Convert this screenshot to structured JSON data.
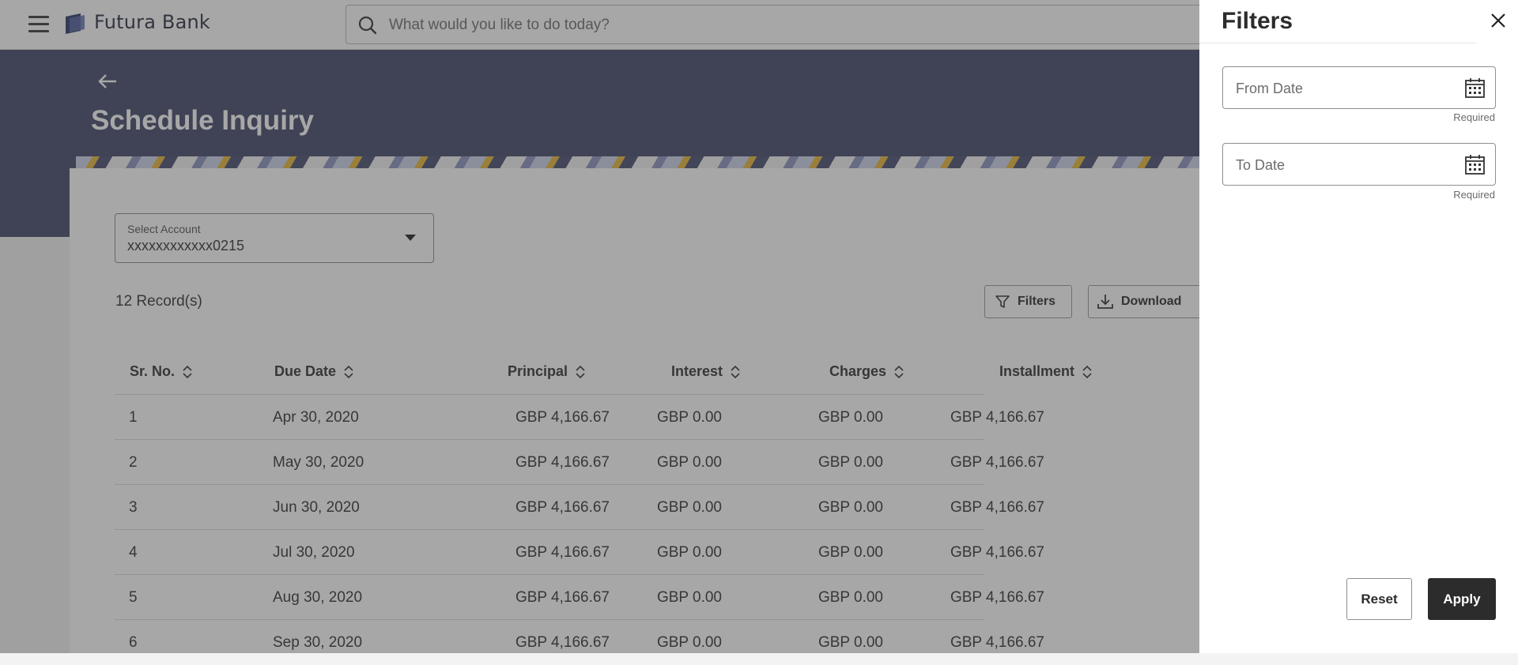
{
  "header": {
    "brand": "Futura Bank",
    "search_placeholder": "What would you like to do today?"
  },
  "page": {
    "title": "Schedule Inquiry"
  },
  "account": {
    "label": "Select Account",
    "value": "xxxxxxxxxxxx0215"
  },
  "records": "12 Record(s)",
  "toolbar": {
    "filters_label": "Filters",
    "download_label": "Download"
  },
  "table": {
    "columns": [
      "Sr. No.",
      "Due Date",
      "Principal",
      "Interest",
      "Charges",
      "Installment"
    ],
    "rows": [
      {
        "sr": "1",
        "due": "Apr 30, 2020",
        "principal": "GBP 4,166.67",
        "interest": "GBP 0.00",
        "charges": "GBP 0.00",
        "installment": "GBP 4,166.67"
      },
      {
        "sr": "2",
        "due": "May 30, 2020",
        "principal": "GBP 4,166.67",
        "interest": "GBP 0.00",
        "charges": "GBP 0.00",
        "installment": "GBP 4,166.67"
      },
      {
        "sr": "3",
        "due": "Jun 30, 2020",
        "principal": "GBP 4,166.67",
        "interest": "GBP 0.00",
        "charges": "GBP 0.00",
        "installment": "GBP 4,166.67"
      },
      {
        "sr": "4",
        "due": "Jul 30, 2020",
        "principal": "GBP 4,166.67",
        "interest": "GBP 0.00",
        "charges": "GBP 0.00",
        "installment": "GBP 4,166.67"
      },
      {
        "sr": "5",
        "due": "Aug 30, 2020",
        "principal": "GBP 4,166.67",
        "interest": "GBP 0.00",
        "charges": "GBP 0.00",
        "installment": "GBP 4,166.67"
      },
      {
        "sr": "6",
        "due": "Sep 30, 2020",
        "principal": "GBP 4,166.67",
        "interest": "GBP 0.00",
        "charges": "GBP 0.00",
        "installment": "GBP 4,166.67"
      }
    ]
  },
  "filters_panel": {
    "title": "Filters",
    "from_date_placeholder": "From Date",
    "to_date_placeholder": "To Date",
    "required_text": "Required",
    "reset_label": "Reset",
    "apply_label": "Apply"
  },
  "colors": {
    "hero_bg": "#444a6b",
    "primary_button": "#2c2c2c",
    "overlay": "rgba(60,60,60,0.45)"
  },
  "icons": [
    "menu-icon",
    "bank-logo-icon",
    "search-icon",
    "back-arrow-icon",
    "chevron-down-icon",
    "filter-icon",
    "download-icon",
    "sort-icon",
    "close-icon",
    "calendar-icon"
  ]
}
